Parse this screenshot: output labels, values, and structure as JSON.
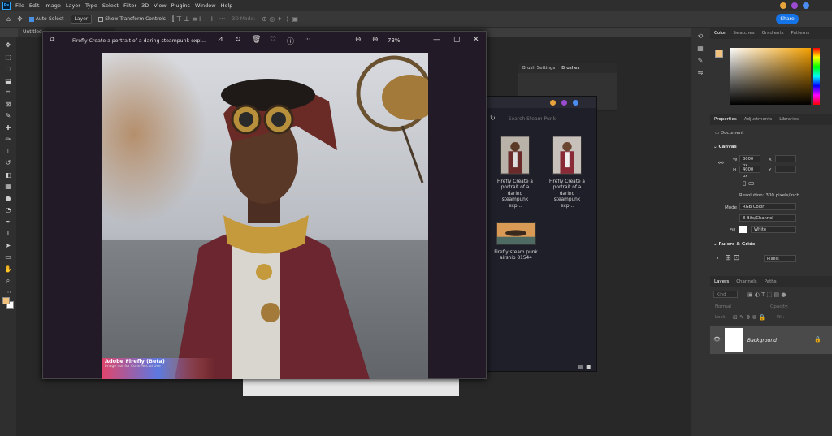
{
  "menu": {
    "logo": "Ps",
    "items": [
      "File",
      "Edit",
      "Image",
      "Layer",
      "Type",
      "Select",
      "Filter",
      "3D",
      "View",
      "Plugins",
      "Window",
      "Help"
    ]
  },
  "options": {
    "auto_select": "Auto-Select",
    "layer": "Layer",
    "show_transform": "Show Transform Controls",
    "mode_3d": "3D Mode:"
  },
  "share": "Share",
  "doc_tab": "Untitled-",
  "firefly": {
    "title": "Firefly Create a portrait of a daring steampunk expl...",
    "zoom": "73%",
    "brand": "Adobe Firefly (Beta)",
    "note": "Image not for Commercial Use"
  },
  "brushes": {
    "tabs": [
      "Brush Settings",
      "Brushes"
    ]
  },
  "stock": {
    "search": "Search Steam Punk",
    "tiles": [
      {
        "label": "Firefly Create a portrait of a daring steampunk exp..."
      },
      {
        "label": "Firefly Create a portrait of a daring steampunk exp..."
      },
      {
        "label": "Firefly steam punk airship 81544"
      }
    ]
  },
  "color_panel": {
    "tabs": [
      "Color",
      "Swatches",
      "Gradients",
      "Patterns"
    ]
  },
  "properties": {
    "tabs": [
      "Properties",
      "Adjustments",
      "Libraries"
    ],
    "document": "Document",
    "canvas": "Canvas",
    "w_label": "W",
    "w_value": "3000 px",
    "h_label": "H",
    "h_value": "4000 px",
    "x_label": "X",
    "y_label": "Y",
    "resolution": "Resolution: 300 pixels/inch",
    "mode_label": "Mode",
    "mode_value": "RGB Color",
    "depth_value": "8 Bits/Channel",
    "fill_label": "Fill",
    "fill_value": "White",
    "rulers": "Rulers & Grids",
    "units": "Pixels"
  },
  "layers": {
    "tabs": [
      "Layers",
      "Channels",
      "Paths"
    ],
    "kind": "Kind",
    "normal": "Normal",
    "opacity": "Opacity:",
    "lock": "Lock:",
    "fill": "Fill:",
    "background": "Background"
  },
  "colors": {
    "fg": "#f1c27d",
    "bg": "#ffffff",
    "accent": "#1473e6"
  }
}
